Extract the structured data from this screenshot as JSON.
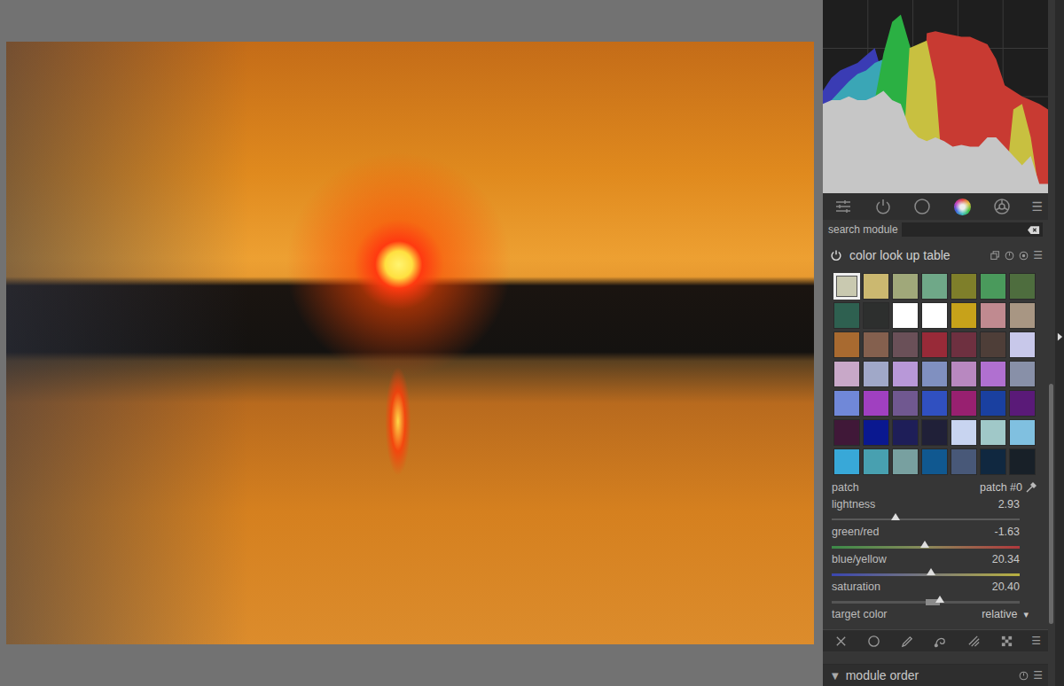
{
  "histogram": {
    "series": [
      {
        "name": "blue",
        "color": "#3a3cb4",
        "values": [
          0.55,
          0.62,
          0.66,
          0.68,
          0.7,
          0.74,
          0.78,
          0.62,
          0.45,
          0.3,
          0.15,
          0.05,
          0,
          0,
          0,
          0,
          0,
          0,
          0,
          0,
          0,
          0,
          0,
          0,
          0,
          0,
          0
        ]
      },
      {
        "name": "cyan",
        "color": "#3aa6b6",
        "values": [
          0.45,
          0.5,
          0.55,
          0.6,
          0.64,
          0.66,
          0.7,
          0.72,
          0.58,
          0.4,
          0.2,
          0.05,
          0,
          0,
          0,
          0,
          0,
          0,
          0,
          0,
          0,
          0,
          0,
          0,
          0,
          0,
          0
        ]
      },
      {
        "name": "green",
        "color": "#2bb043",
        "values": [
          0,
          0,
          0,
          0,
          0,
          0,
          0.5,
          0.75,
          0.92,
          0.96,
          0.8,
          0.65,
          0,
          0,
          0,
          0,
          0,
          0,
          0,
          0,
          0,
          0,
          0,
          0,
          0,
          0,
          0
        ]
      },
      {
        "name": "red",
        "color": "#c83a32",
        "values": [
          0,
          0,
          0,
          0,
          0,
          0,
          0,
          0,
          0,
          0,
          0,
          0,
          0.86,
          0.87,
          0.86,
          0.85,
          0.84,
          0.84,
          0.82,
          0.8,
          0.72,
          0.58,
          0.55,
          0.52,
          0.5,
          0.48,
          0.45
        ]
      },
      {
        "name": "yellow",
        "color": "#c8c040",
        "values": [
          0,
          0,
          0,
          0,
          0,
          0,
          0,
          0,
          0,
          0,
          0.78,
          0.8,
          0.82,
          0.6,
          0,
          0,
          0,
          0,
          0,
          0,
          0,
          0,
          0.45,
          0.48,
          0.3,
          0,
          0
        ]
      },
      {
        "name": "gray",
        "color": "#c6c6c6",
        "values": [
          0.48,
          0.5,
          0.5,
          0.52,
          0.5,
          0.5,
          0.52,
          0.55,
          0.5,
          0.48,
          0.35,
          0.3,
          0.28,
          0.3,
          0.28,
          0.25,
          0.26,
          0.25,
          0.25,
          0.3,
          0.3,
          0.25,
          0.2,
          0.15,
          0.2,
          0.05,
          0.05
        ]
      }
    ]
  },
  "module_groups": [
    {
      "kind": "sliders",
      "selected": false
    },
    {
      "kind": "power",
      "selected": false
    },
    {
      "kind": "circle",
      "selected": false
    },
    {
      "kind": "color",
      "selected": true
    },
    {
      "kind": "ball",
      "selected": false
    }
  ],
  "menu_glyph": "☰",
  "search": {
    "label": "search module",
    "value": ""
  },
  "module": {
    "title": "color look up table",
    "enabled": true
  },
  "patches": [
    {
      "color": "#c9c9b0",
      "selected": true
    },
    {
      "color": "#cbb870",
      "selected": false
    },
    {
      "color": "#a0a87a",
      "selected": false
    },
    {
      "color": "#6fa888",
      "selected": false
    },
    {
      "color": "#7f7f2a",
      "selected": false
    },
    {
      "color": "#4a9a5c",
      "selected": false
    },
    {
      "color": "#4e6d3e",
      "selected": false
    },
    {
      "color": "#2e6050",
      "selected": false
    },
    {
      "color": "#2d2f2e",
      "selected": false
    },
    {
      "color": "#ffffff",
      "selected": false
    },
    {
      "color": "#ffffff",
      "selected": false
    },
    {
      "color": "#c7a21a",
      "selected": false
    },
    {
      "color": "#c08a90",
      "selected": false
    },
    {
      "color": "#a89683",
      "selected": false
    },
    {
      "color": "#a86a30",
      "selected": false
    },
    {
      "color": "#84604e",
      "selected": false
    },
    {
      "color": "#6a5058",
      "selected": false
    },
    {
      "color": "#982a38",
      "selected": false
    },
    {
      "color": "#6e3040",
      "selected": false
    },
    {
      "color": "#4e3e38",
      "selected": false
    },
    {
      "color": "#c8c8ea",
      "selected": false
    },
    {
      "color": "#c8a8c8",
      "selected": false
    },
    {
      "color": "#a0a8c8",
      "selected": false
    },
    {
      "color": "#b898d8",
      "selected": false
    },
    {
      "color": "#8090c0",
      "selected": false
    },
    {
      "color": "#b888c0",
      "selected": false
    },
    {
      "color": "#b070d0",
      "selected": false
    },
    {
      "color": "#8890a8",
      "selected": false
    },
    {
      "color": "#7088d8",
      "selected": false
    },
    {
      "color": "#a040c0",
      "selected": false
    },
    {
      "color": "#705890",
      "selected": false
    },
    {
      "color": "#3050c0",
      "selected": false
    },
    {
      "color": "#982070",
      "selected": false
    },
    {
      "color": "#1a40a0",
      "selected": false
    },
    {
      "color": "#5a1a78",
      "selected": false
    },
    {
      "color": "#401838",
      "selected": false
    },
    {
      "color": "#0a1890",
      "selected": false
    },
    {
      "color": "#1e1e58",
      "selected": false
    },
    {
      "color": "#202038",
      "selected": false
    },
    {
      "color": "#c8d4f0",
      "selected": false
    },
    {
      "color": "#a0c8c8",
      "selected": false
    },
    {
      "color": "#80c0e0",
      "selected": false
    },
    {
      "color": "#38a8d8",
      "selected": false
    },
    {
      "color": "#48a0b0",
      "selected": false
    },
    {
      "color": "#78a0a0",
      "selected": false
    },
    {
      "color": "#105890",
      "selected": false
    },
    {
      "color": "#485878",
      "selected": false
    },
    {
      "color": "#102840",
      "selected": false
    },
    {
      "color": "#182028",
      "selected": false
    }
  ],
  "patch": {
    "label": "patch",
    "value": "patch #0"
  },
  "sliders": [
    {
      "kind": "plain",
      "label": "lightness",
      "reading": "2.93",
      "level": 0.34
    },
    {
      "kind": "greenred",
      "label": "green/red",
      "reading": "-1.63",
      "level": 0.495
    },
    {
      "kind": "blueyellow",
      "label": "blue/yellow",
      "reading": "20.34",
      "level": 0.53
    },
    {
      "kind": "saturation",
      "label": "saturation",
      "reading": "20.40",
      "level": 0.575
    }
  ],
  "target": {
    "label": "target color",
    "value": "relative",
    "arrow": "▾"
  },
  "mask_tools": [
    {
      "kind": "off",
      "selected": false
    },
    {
      "kind": "circle",
      "selected": false
    },
    {
      "kind": "pencil",
      "selected": false
    },
    {
      "kind": "path",
      "selected": false
    },
    {
      "kind": "brush",
      "selected": false
    },
    {
      "kind": "raster",
      "selected": false
    }
  ],
  "collapsed_module": {
    "arrow": "▼",
    "label": "module order"
  },
  "scrollbar": {
    "offset": 0.56,
    "level": 0.35
  }
}
